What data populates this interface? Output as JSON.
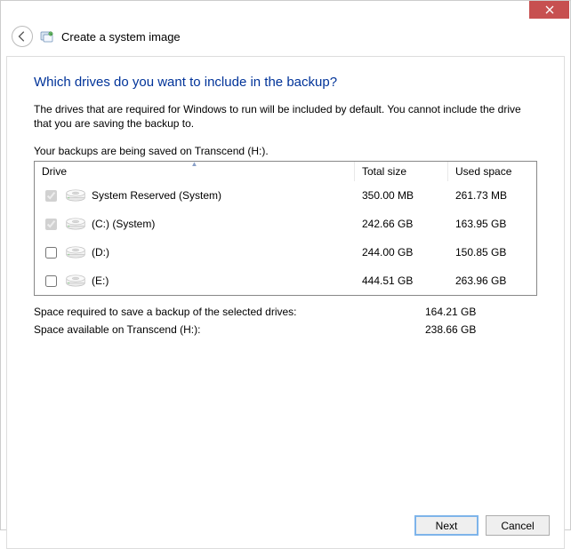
{
  "titlebar": {},
  "header": {
    "page_title": "Create a system image"
  },
  "main": {
    "heading": "Which drives do you want to include in the backup?",
    "description": "The drives that are required for Windows to run will be included by default. You cannot include the drive that you are saving the backup to.",
    "saved_on": "Your backups are being saved on Transcend (H:).",
    "columns": {
      "drive": "Drive",
      "total": "Total size",
      "used": "Used space"
    },
    "drives": [
      {
        "checked": true,
        "disabled": true,
        "label": "System Reserved (System)",
        "total": "350.00 MB",
        "used": "261.73 MB"
      },
      {
        "checked": true,
        "disabled": true,
        "label": "(C:) (System)",
        "total": "242.66 GB",
        "used": "163.95 GB"
      },
      {
        "checked": false,
        "disabled": false,
        "label": "(D:)",
        "total": "244.00 GB",
        "used": "150.85 GB"
      },
      {
        "checked": false,
        "disabled": false,
        "label": "(E:)",
        "total": "444.51 GB",
        "used": "263.96 GB"
      }
    ],
    "summary": {
      "required_label": "Space required to save a backup of the selected drives:",
      "required_value": "164.21 GB",
      "available_label": "Space available on Transcend (H:):",
      "available_value": "238.66 GB"
    }
  },
  "footer": {
    "next": "Next",
    "cancel": "Cancel"
  }
}
